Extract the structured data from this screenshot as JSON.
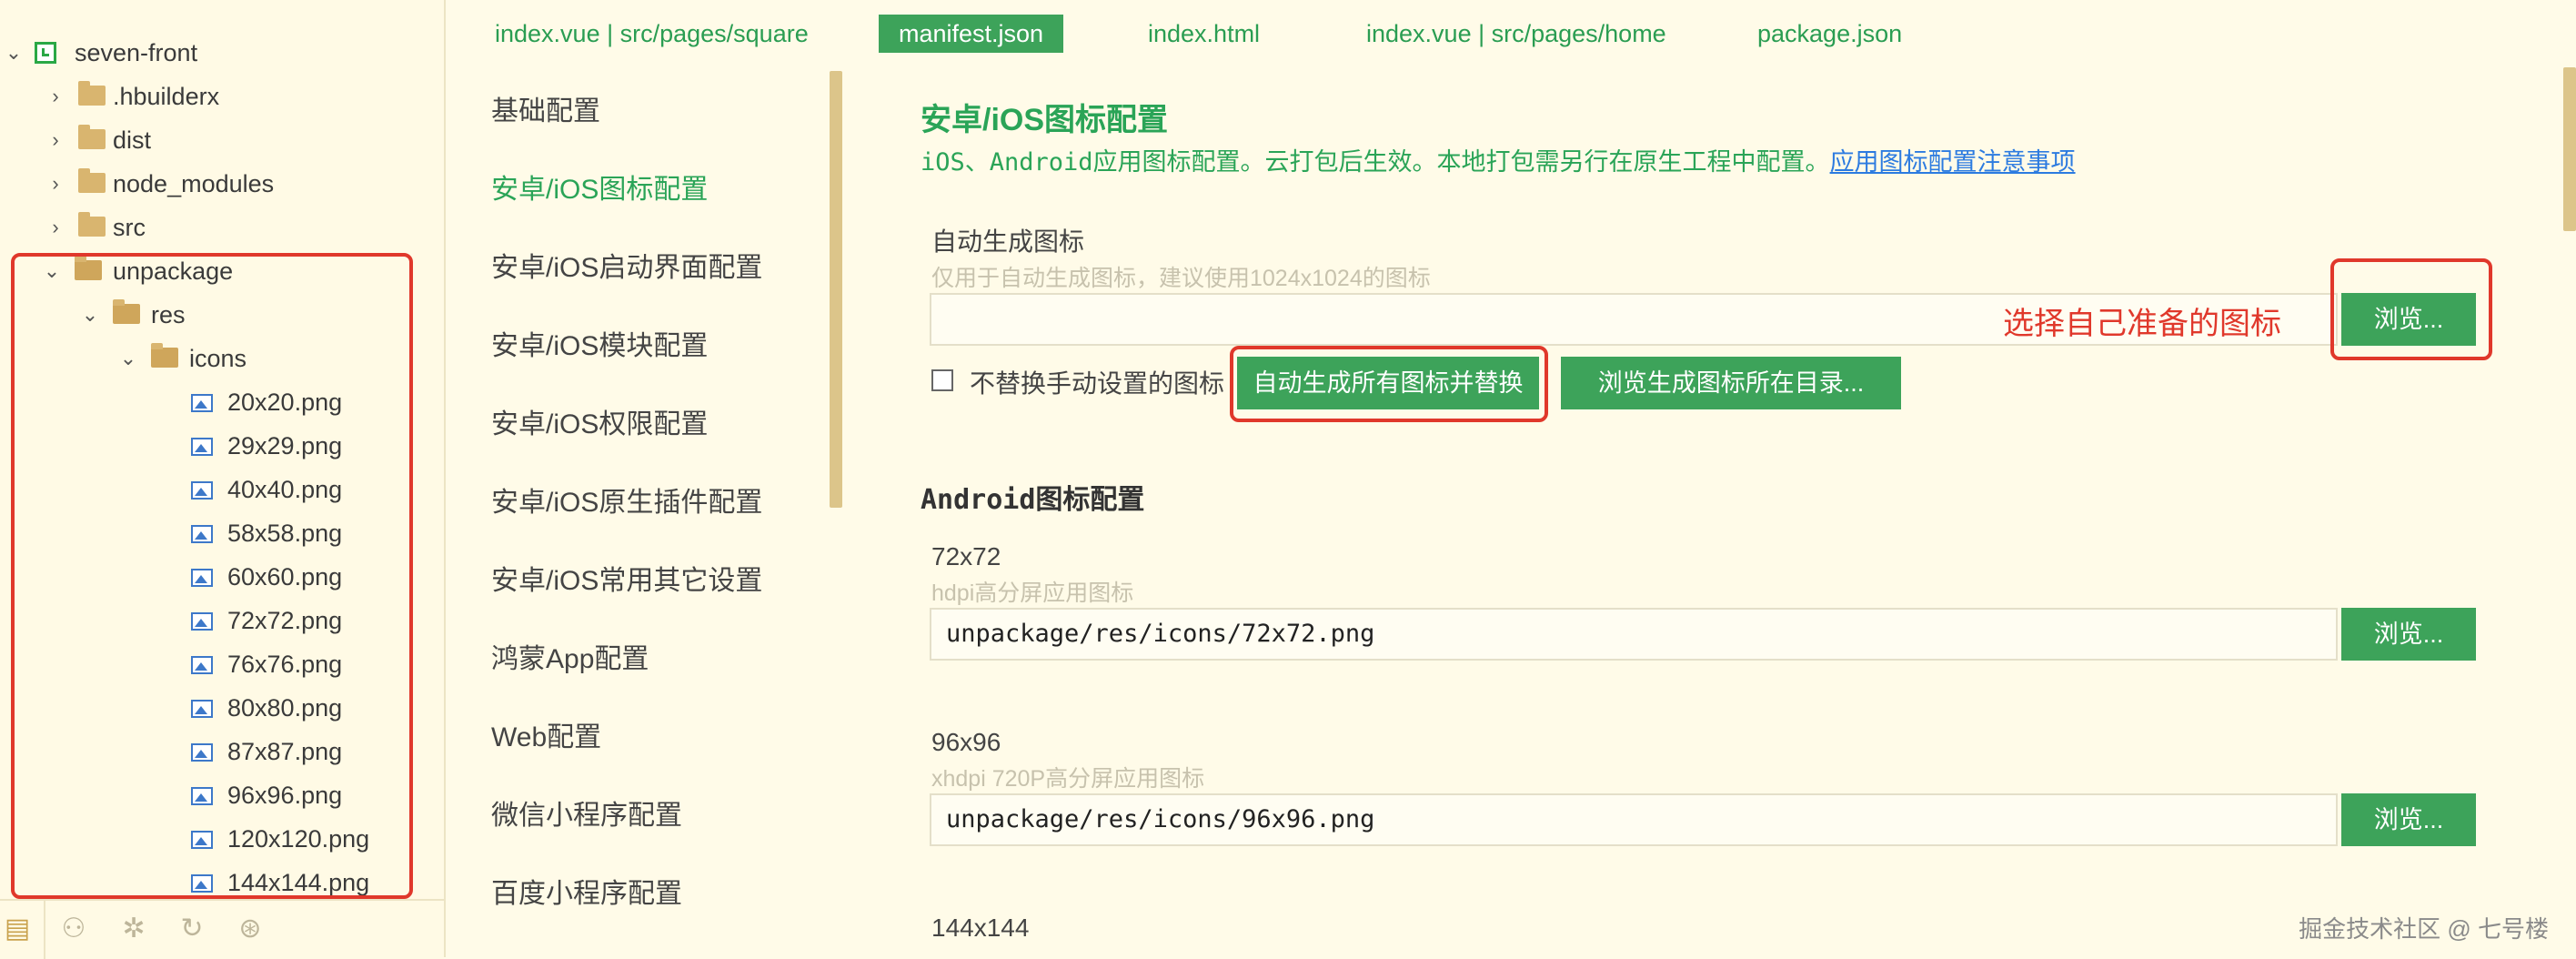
{
  "explorer": {
    "project": "seven-front",
    "items": [
      {
        "name": ".hbuilderx"
      },
      {
        "name": "dist"
      },
      {
        "name": "node_modules"
      },
      {
        "name": "src"
      },
      {
        "name": "unpackage"
      },
      {
        "name": "res"
      },
      {
        "name": "icons"
      }
    ],
    "files": [
      "20x20.png",
      "29x29.png",
      "40x40.png",
      "58x58.png",
      "60x60.png",
      "72x72.png",
      "76x76.png",
      "80x80.png",
      "87x87.png",
      "96x96.png",
      "120x120.png",
      "144x144.png"
    ]
  },
  "tabs": [
    {
      "label": "index.vue | src/pages/square",
      "active": false
    },
    {
      "label": "manifest.json",
      "active": true
    },
    {
      "label": "index.html",
      "active": false
    },
    {
      "label": "index.vue | src/pages/home",
      "active": false
    },
    {
      "label": "package.json",
      "active": false
    }
  ],
  "nav": [
    {
      "label": "基础配置",
      "active": false
    },
    {
      "label": "安卓/iOS图标配置",
      "active": true
    },
    {
      "label": "安卓/iOS启动界面配置",
      "active": false
    },
    {
      "label": "安卓/iOS模块配置",
      "active": false
    },
    {
      "label": "安卓/iOS权限配置",
      "active": false
    },
    {
      "label": "安卓/iOS原生插件配置",
      "active": false
    },
    {
      "label": "安卓/iOS常用其它设置",
      "active": false
    },
    {
      "label": "鸿蒙App配置",
      "active": false
    },
    {
      "label": "Web配置",
      "active": false
    },
    {
      "label": "微信小程序配置",
      "active": false
    },
    {
      "label": "百度小程序配置",
      "active": false
    }
  ],
  "content": {
    "title": "安卓/iOS图标配置",
    "desc": "iOS、Android应用图标配置。云打包后生效。本地打包需另行在原生工程中配置。",
    "desc_link": "应用图标配置注意事项",
    "auto": {
      "label": "自动生成图标",
      "hint": "仅用于自动生成图标，建议使用1024x1024的图标",
      "value": "",
      "annotation": "选择自己准备的图标",
      "browse": "浏览...",
      "checkbox_label": "不替换手动设置的图标",
      "checkbox_checked": false,
      "generate_button": "自动生成所有图标并替换",
      "browse_dir_button": "浏览生成图标所在目录..."
    },
    "android_title": "Android图标配置",
    "icons": [
      {
        "size": "72x72",
        "hint": "hdpi高分屏应用图标",
        "value": "unpackage/res/icons/72x72.png",
        "browse": "浏览..."
      },
      {
        "size": "96x96",
        "hint": "xhdpi 720P高分屏应用图标",
        "value": "unpackage/res/icons/96x96.png",
        "browse": "浏览..."
      },
      {
        "size": "144x144"
      }
    ]
  },
  "watermark": "掘金技术社区 @ 七号楼",
  "colors": {
    "accent": "#3da35a",
    "title": "#2aa457",
    "highlight": "#e0382b",
    "link": "#2c7be0"
  }
}
